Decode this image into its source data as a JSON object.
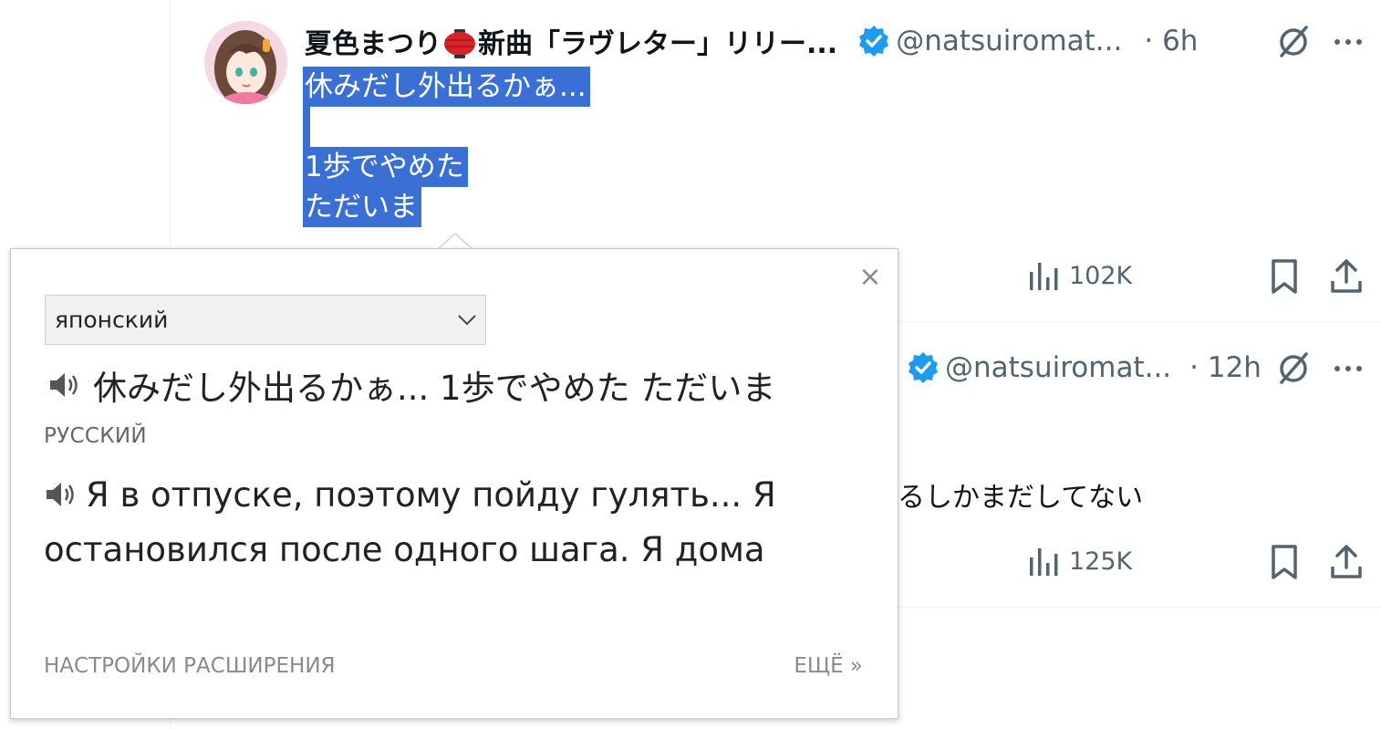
{
  "tweet1": {
    "display_name": "夏色まつり",
    "display_name_suffix": "新曲「ラヴレター」リリー...",
    "handle": "@natsuiromat...",
    "time": "· 6h",
    "body_lines": [
      "休みだし外出るかぁ...",
      "",
      "1歩でやめた",
      "ただいま"
    ],
    "views": "102K"
  },
  "tweet2": {
    "handle": "@natsuiromat...",
    "time": "· 12h",
    "body_tail": "るしかまだしてない",
    "views": "125K"
  },
  "popup": {
    "close_label": "×",
    "source_language": "японский",
    "source_text": "休みだし外出るかぁ... 1歩でやめた ただいま",
    "target_language_label": "РУССКИЙ",
    "target_text": "Я в отпуске, поэтому пойду гулять... Я остановился после одного шага. Я дома",
    "settings_link": "НАСТРОЙКИ РАСШИРЕНИЯ",
    "more_link": "ЕЩЁ »"
  },
  "icons": {
    "verified": "verified-badge-icon",
    "grok": "grok-icon",
    "more": "more-icon",
    "views": "analytics-icon",
    "bookmark": "bookmark-icon",
    "share": "share-icon",
    "speaker": "speaker-icon",
    "lantern": "red-lantern-emoji"
  },
  "colors": {
    "selection": "#3a6fd6",
    "verified_blue": "#1d9bf0",
    "secondary_text": "#536471"
  }
}
